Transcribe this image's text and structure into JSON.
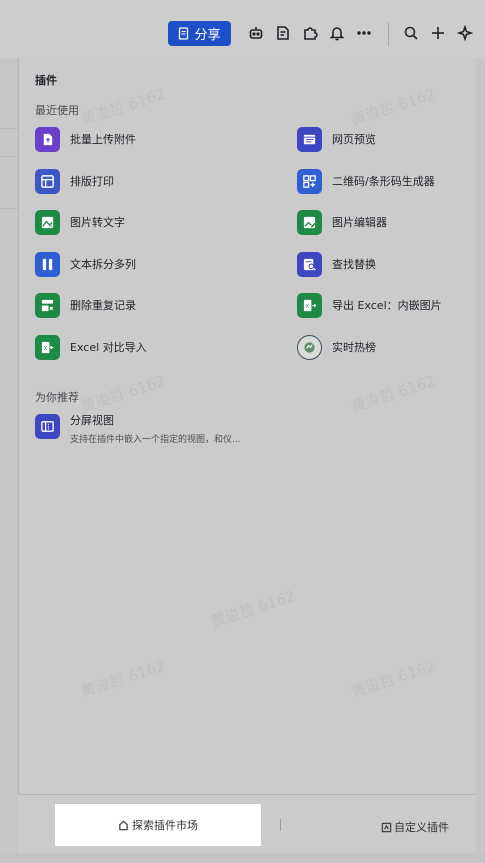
{
  "toolbar": {
    "share_label": "分享",
    "icons": [
      "robot-icon",
      "doc-icon",
      "puzzle-icon",
      "bell-icon",
      "more-icon",
      "search-icon",
      "plus-icon",
      "sparkle-icon"
    ]
  },
  "panel": {
    "title": "插件",
    "recent_label": "最近使用",
    "recommend_label": "为你推荐"
  },
  "recent_plugins": [
    {
      "label": "批量上传附件",
      "color": "#6a3fc8",
      "icon": "upload-icon"
    },
    {
      "label": "网页预览",
      "color": "#3d47c2",
      "icon": "webpage-icon"
    },
    {
      "label": "排版打印",
      "color": "#3f57c4",
      "icon": "layout-icon"
    },
    {
      "label": "二维码/条形码生成器",
      "color": "#2f5fd2",
      "icon": "qrcode-icon"
    },
    {
      "label": "图片转文字",
      "color": "#1f8a45",
      "icon": "image-text-icon"
    },
    {
      "label": "图片编辑器",
      "color": "#1e8a44",
      "icon": "image-edit-icon"
    },
    {
      "label": "文本拆分多列",
      "color": "#2f5fd2",
      "icon": "split-columns-icon"
    },
    {
      "label": "查找替换",
      "color": "#3d47c2",
      "icon": "find-replace-icon"
    },
    {
      "label": "删除重复记录",
      "color": "#1f8a45",
      "icon": "delete-duplicate-icon"
    },
    {
      "label": "导出 Excel：内嵌图片",
      "color": "#1f8a45",
      "icon": "excel-export-icon"
    },
    {
      "label": "Excel 对比导入",
      "color": "#1f8a45",
      "icon": "excel-compare-icon"
    },
    {
      "label": "实时热榜",
      "color": "#d9dcd6",
      "icon": "hot-list-icon"
    }
  ],
  "recommended": {
    "title": "分屏视图",
    "description": "支持在插件中嵌入一个指定的视图，和仪..."
  },
  "footer": {
    "explore_label": "探索插件市场",
    "custom_label": "自定义插件"
  },
  "watermark": "黄浚哲 6162"
}
